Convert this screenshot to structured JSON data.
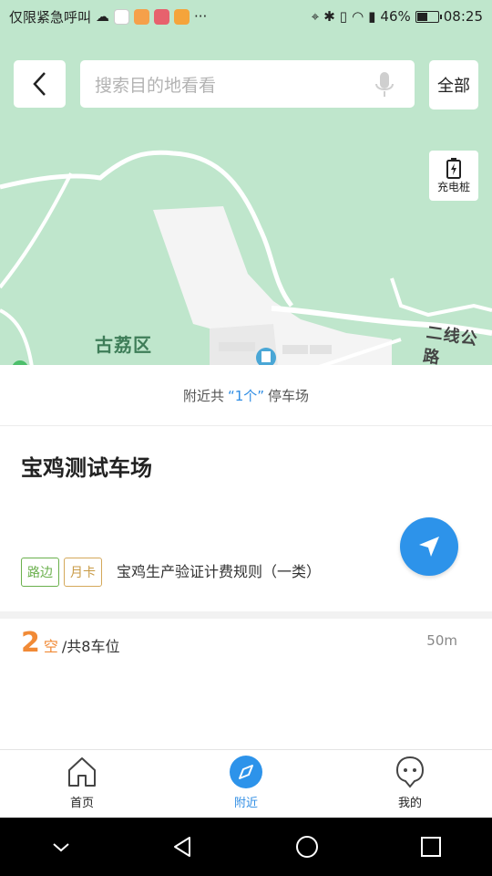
{
  "status_bar": {
    "carrier": "仅限紧急呼叫",
    "more": "···",
    "battery_percent": "46%",
    "battery_level": 0.46,
    "time": "08:25"
  },
  "map": {
    "district_label": "古荔区",
    "road_label": "二线公路",
    "colors": {
      "land": "#bfe6cc",
      "road": "#ffffff",
      "urban": "#f4f4f4"
    }
  },
  "search": {
    "placeholder": "搜索目的地看看",
    "all_button": "全部",
    "charge_button": "充电桩"
  },
  "nearby": {
    "prefix": "附近共",
    "count": "“1个”",
    "suffix": "停车场"
  },
  "lot": {
    "name": "宝鸡测试车场",
    "tags": [
      "路边",
      "月卡"
    ],
    "rule": "宝鸡生产验证计费规则（一类）",
    "free_spots": "2",
    "free_unit": "空",
    "total": "/共8车位",
    "distance": "50m"
  },
  "tabs": [
    {
      "label": "首页",
      "icon": "home-icon"
    },
    {
      "label": "附近",
      "icon": "compass-icon"
    },
    {
      "label": "我的",
      "icon": "profile-icon"
    }
  ],
  "accent": "#2f8de4",
  "orange": "#f18a36"
}
